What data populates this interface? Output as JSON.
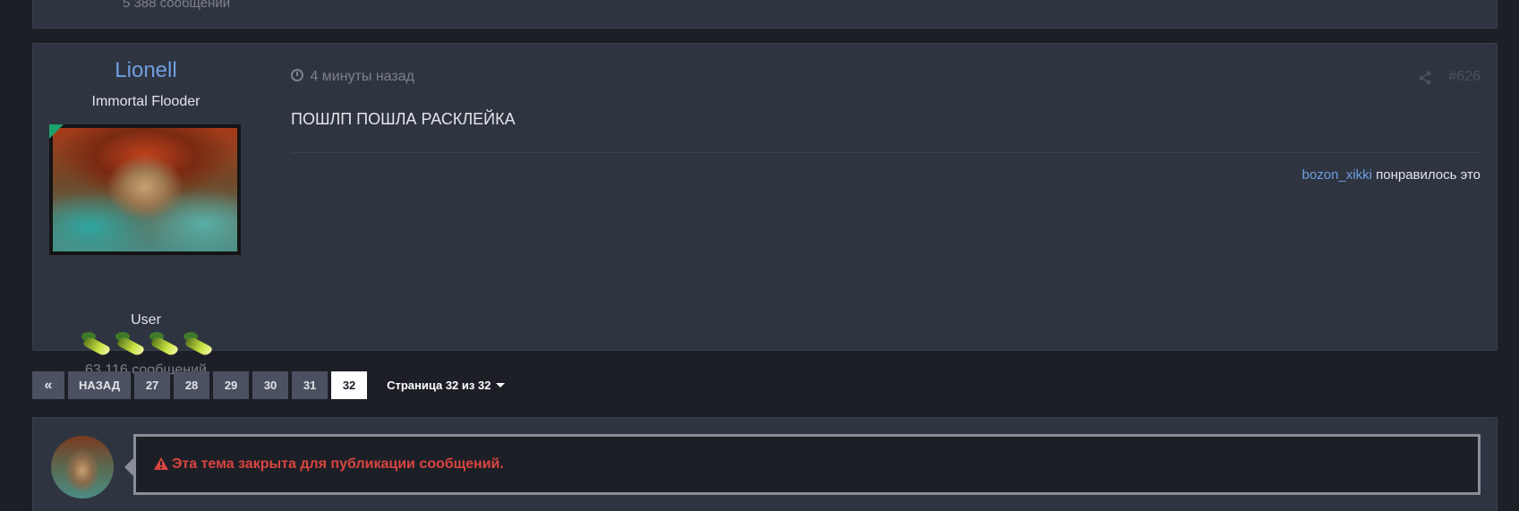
{
  "previous_post": {
    "message_count": "5 388 сообщений"
  },
  "post": {
    "author": {
      "name": "Lionell",
      "rank_title": "Immortal Flooder",
      "group": "User",
      "message_count": "63 116 сообщений",
      "badge_count": 4,
      "online_indicator_color": "#1aa36a"
    },
    "time": "4 минуты назад",
    "post_number": "#626",
    "content": "ПОШЛП ПОШЛА РАСКЛЕЙКА",
    "likes": {
      "user": "bozon_xikki",
      "suffix": " понравилось это"
    }
  },
  "pagination": {
    "first_icon": "double-chevron-left-icon",
    "prev_label": "НАЗАД",
    "pages": [
      "27",
      "28",
      "29",
      "30",
      "31",
      "32"
    ],
    "current_page": "32",
    "page_info": "Страница 32 из 32"
  },
  "reply": {
    "locked_message": "Эта тема закрыта для публикации сообщений.",
    "locked_color": "#d9453f"
  },
  "colors": {
    "background": "#1d1f27",
    "panel": "#2f3441",
    "link": "#6f9fe0"
  }
}
